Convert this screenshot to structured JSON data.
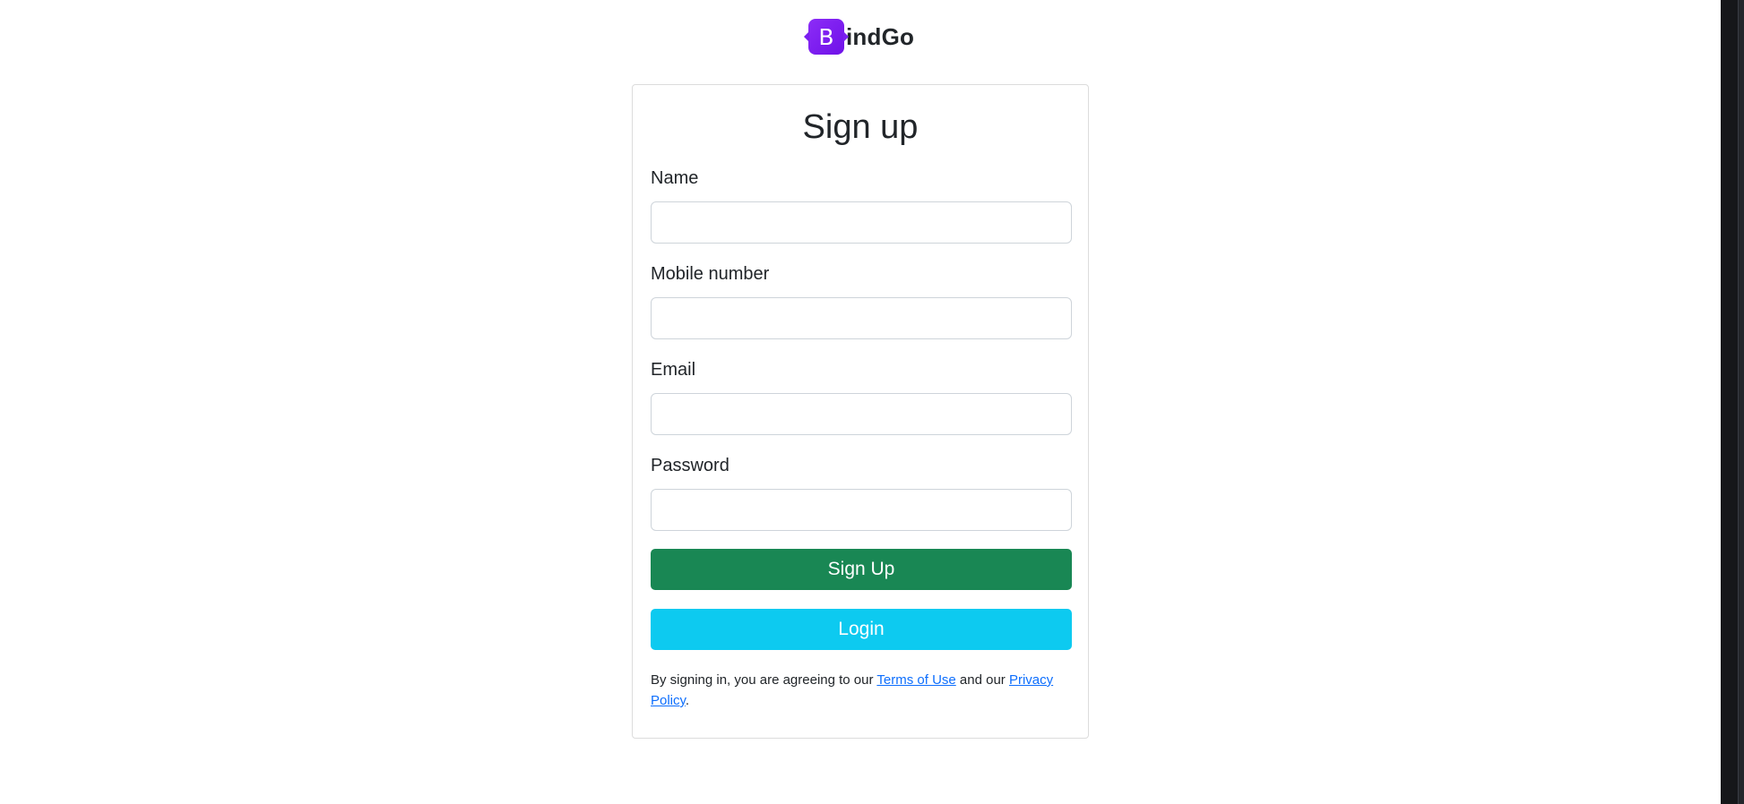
{
  "brand": {
    "logo_letter": "B",
    "name": "indGo",
    "logo_color": "#7a1ff0"
  },
  "form": {
    "title": "Sign up",
    "fields": [
      {
        "label": "Name",
        "value": "",
        "placeholder": ""
      },
      {
        "label": "Mobile number",
        "value": "",
        "placeholder": ""
      },
      {
        "label": "Email",
        "value": "",
        "placeholder": ""
      },
      {
        "label": "Password",
        "value": "",
        "placeholder": ""
      }
    ],
    "signup_button": "Sign Up",
    "login_button": "Login",
    "terms": {
      "prefix": "By signing in, you are agreeing to our ",
      "terms_link": "Terms of Use",
      "middle": " and our ",
      "privacy_link": "Privacy Policy",
      "suffix": "."
    }
  },
  "colors": {
    "signup_button": "#198754",
    "login_button": "#0dcaf0",
    "link": "#0d6efd"
  }
}
